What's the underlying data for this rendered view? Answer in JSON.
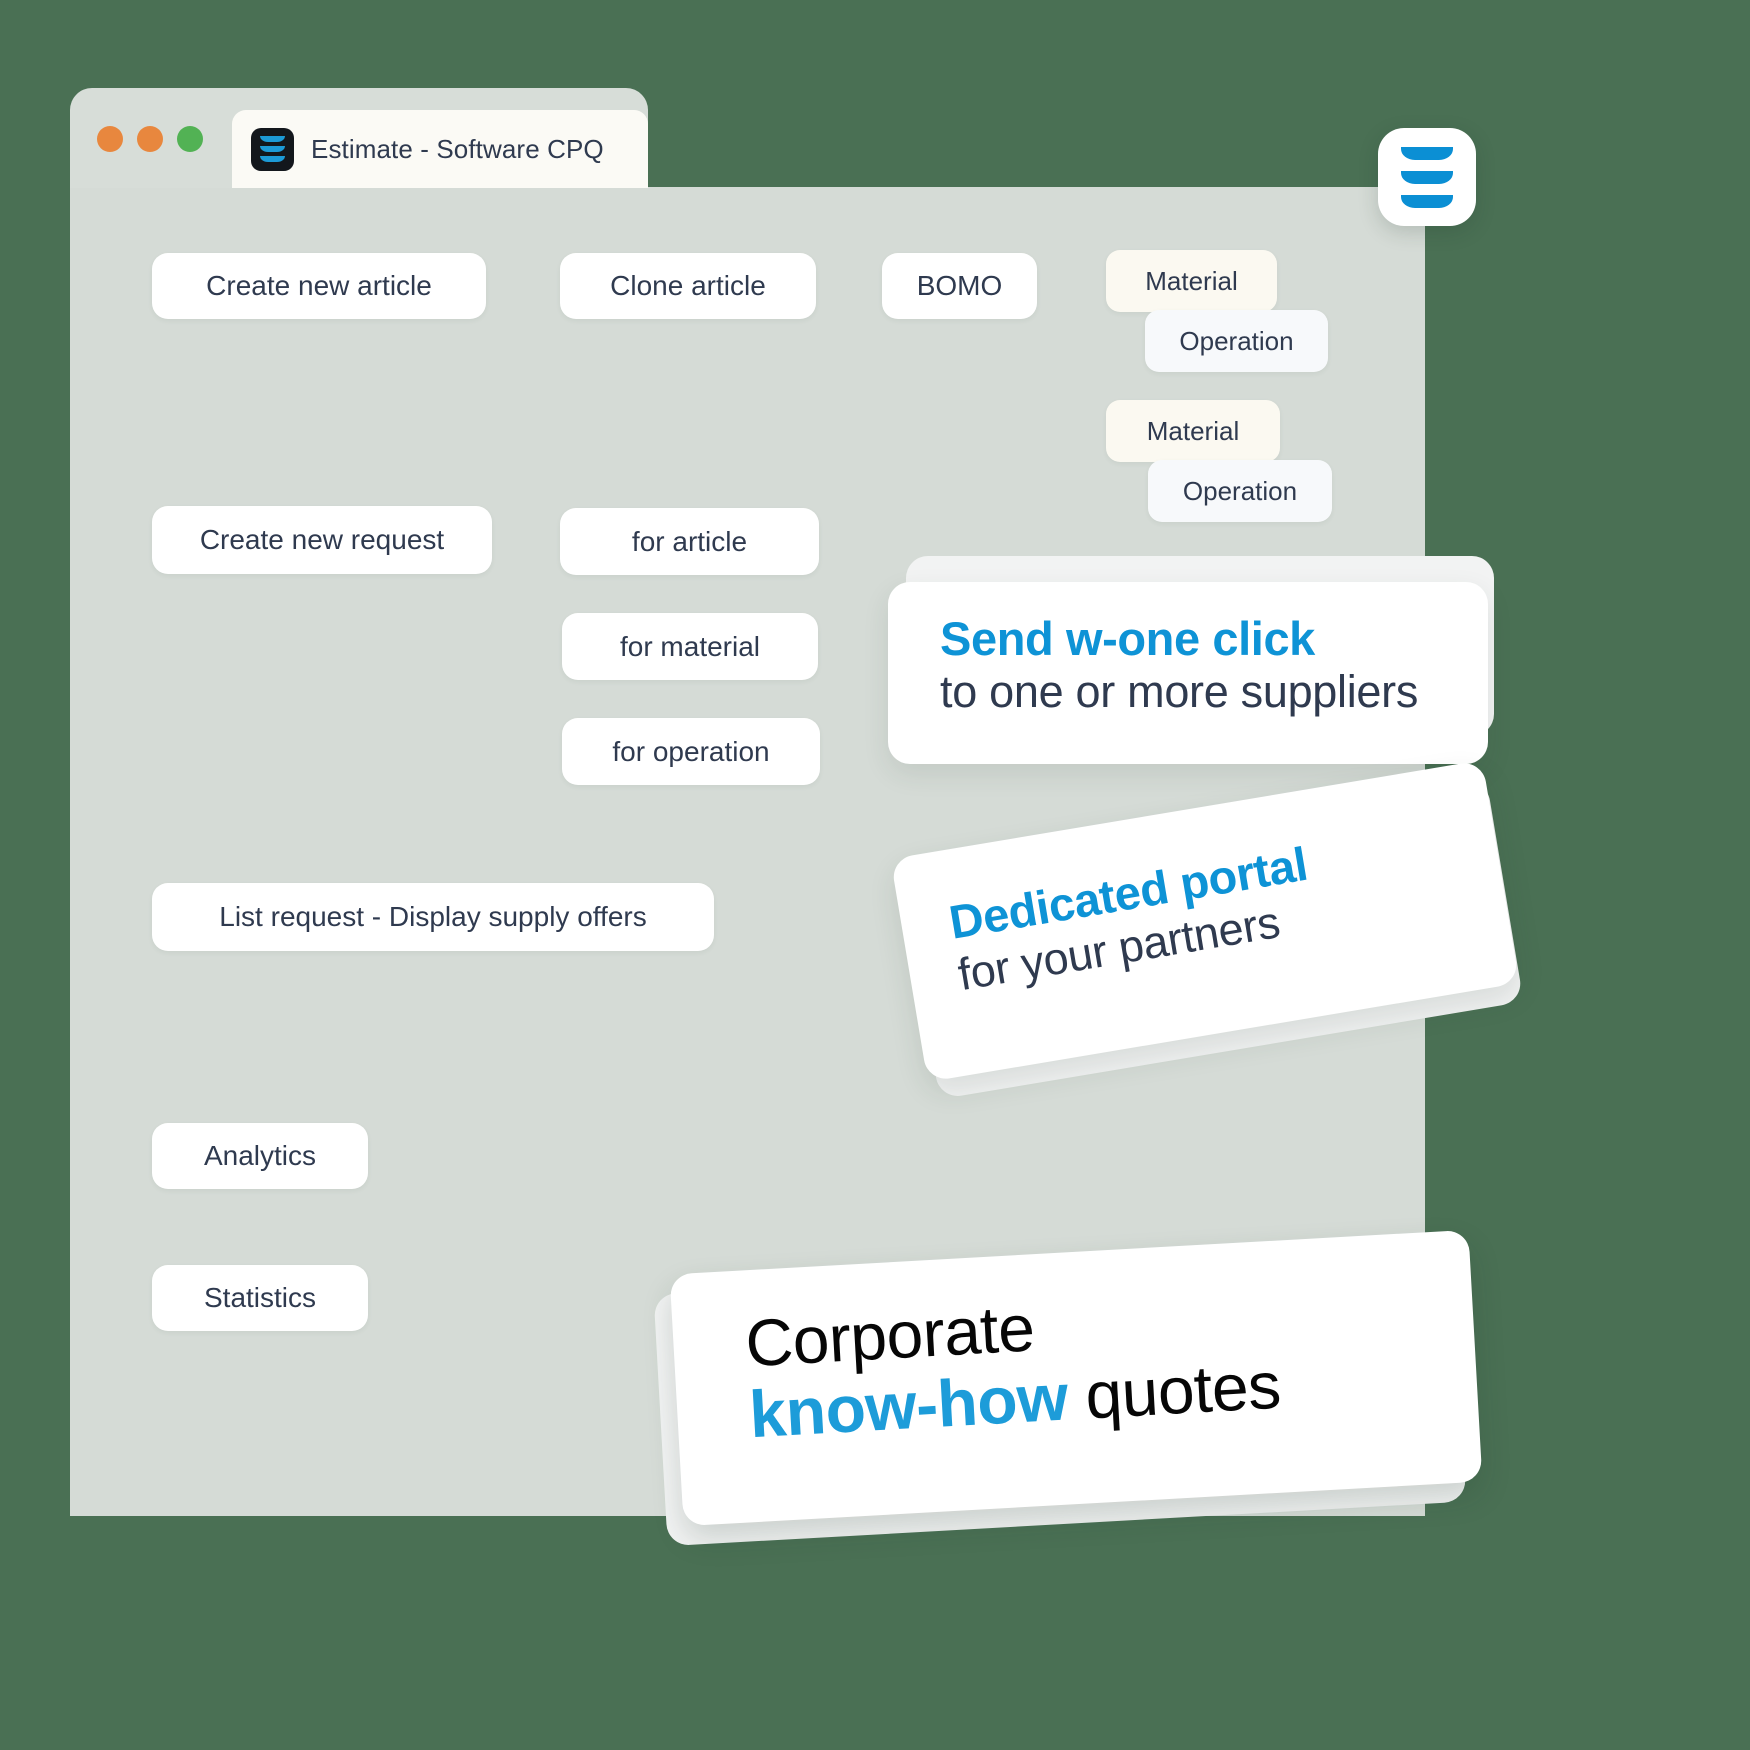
{
  "background_color": "#4a7054",
  "accent_color": "#0e93d6",
  "text_color": "#2f3a4f",
  "panel_color": "#d5dbd6",
  "browser": {
    "titlebar": {
      "traffic_lights": [
        {
          "name": "close-dot",
          "color": "#e8873e"
        },
        {
          "name": "minimize-dot",
          "color": "#e8873e"
        },
        {
          "name": "maximize-dot",
          "color": "#52b254"
        }
      ]
    },
    "tab": {
      "favicon_name": "stacked-layers-icon",
      "title": "Estimate - Software CPQ"
    }
  },
  "app_badge": {
    "icon_name": "hamburger-layers-icon",
    "bars": 3
  },
  "buttons": {
    "create_new_article": "Create new article",
    "clone_article": "Clone article",
    "bomo": "BOMO",
    "material_1": "Material",
    "operation_1": "Operation",
    "material_2": "Material",
    "operation_2": "Operation",
    "create_new_request": "Create new request",
    "for_article": "for article",
    "for_material": "for material",
    "for_operation": "for operation",
    "list_request": "List request - Display supply offers",
    "analytics": "Analytics",
    "statistics": "Statistics"
  },
  "callouts": {
    "send": {
      "line1": "Send w-one click",
      "line2": "to one or more suppliers"
    },
    "portal": {
      "line1": "Dedicated portal",
      "line2": "for your partners"
    },
    "corporate": {
      "line1": "Corporate",
      "line2_highlight": "know-how",
      "line2_rest": " quotes"
    }
  }
}
